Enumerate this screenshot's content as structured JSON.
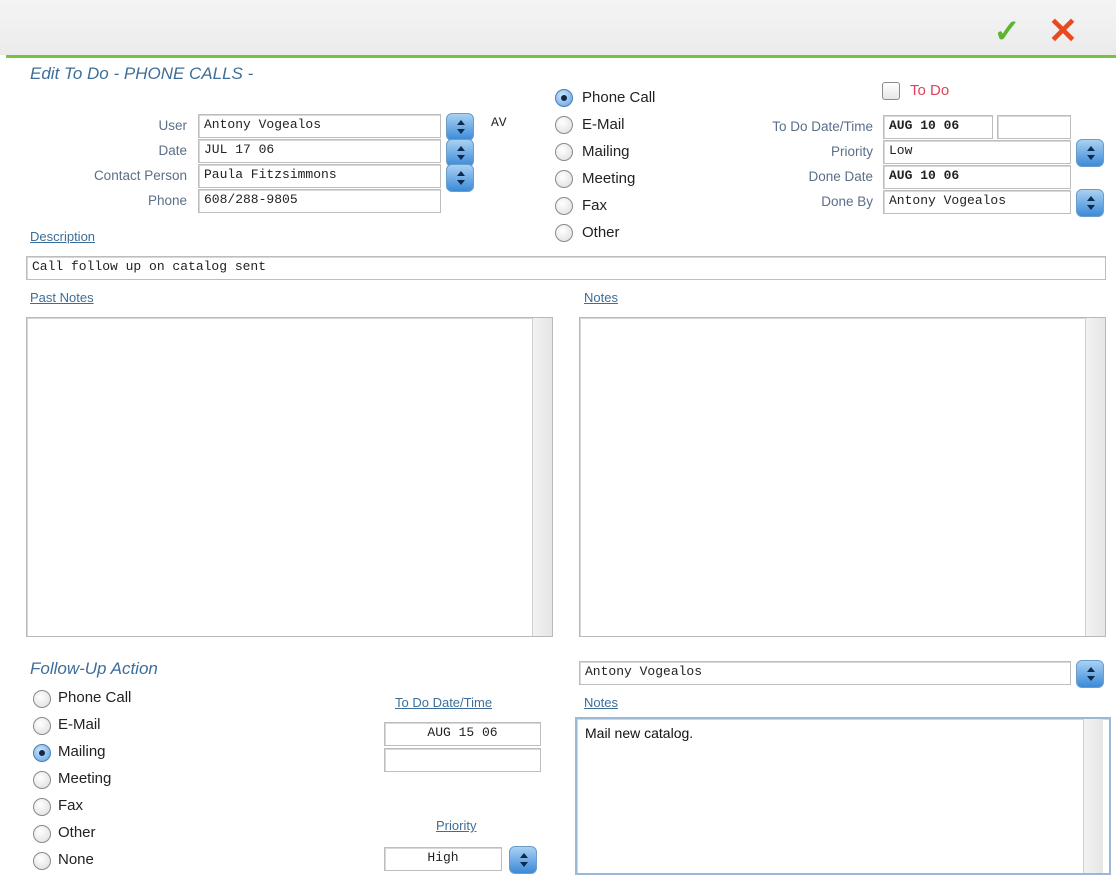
{
  "toolbar": {
    "ok_icon": "checkmark-icon",
    "cancel_icon": "x-close-icon",
    "ok_glyph": "✓",
    "cancel_glyph": "✕"
  },
  "header": {
    "title": "Edit To Do  -  PHONE CALLS -"
  },
  "contact": {
    "user_label": "User",
    "user_value": "Antony Vogealos",
    "user_initials": "AV",
    "date_label": "Date",
    "date_value": "JUL 17 06",
    "contact_label": "Contact Person",
    "contact_value": "Paula Fitzsimmons",
    "phone_label": "Phone",
    "phone_value": "608/288-9805"
  },
  "type_options": {
    "selected": "Phone Call",
    "items": [
      "Phone Call",
      "E-Mail",
      "Mailing",
      "Meeting",
      "Fax",
      "Other"
    ]
  },
  "todo": {
    "checkbox_label": "To Do",
    "date_time_label": "To Do Date/Time",
    "date_value": "AUG 10 06",
    "time_value": "",
    "priority_label": "Priority",
    "priority_value": "Low",
    "done_date_label": "Done Date",
    "done_date_value": "AUG 10 06",
    "done_by_label": "Done By",
    "done_by_value": "Antony Vogealos"
  },
  "description": {
    "label": "Description",
    "value": "Call follow up on catalog sent"
  },
  "past_notes": {
    "label": "Past Notes",
    "value": ""
  },
  "notes": {
    "label": "Notes",
    "value": ""
  },
  "follow_up": {
    "title": "Follow-Up Action",
    "selected": "Mailing",
    "items": [
      "Phone Call",
      "E-Mail",
      "Mailing",
      "Meeting",
      "Fax",
      "Other",
      "None"
    ],
    "date_time_label": "To Do Date/Time",
    "date_value": "AUG 15 06",
    "time_value": "",
    "priority_label": "Priority",
    "priority_value": "High",
    "assignee_value": "Antony Vogealos",
    "notes_label": "Notes",
    "notes_value": "Mail new catalog."
  },
  "colors": {
    "accent_green": "#79c143",
    "ok_green": "#5cb531",
    "cancel_red": "#e84a20",
    "link_blue": "#3d6e9a",
    "todo_red": "#e0415b"
  }
}
